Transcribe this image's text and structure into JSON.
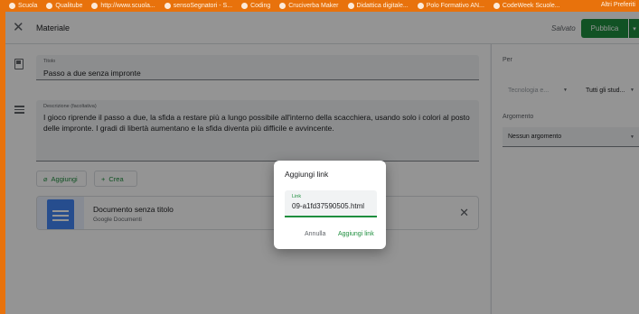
{
  "bookmarks": [
    {
      "label": "Scuola"
    },
    {
      "label": "Qualitube"
    },
    {
      "label": "http://www.scuola..."
    },
    {
      "label": "sensoSegnatori - S..."
    },
    {
      "label": "Coding"
    },
    {
      "label": "Cruciverba Maker"
    },
    {
      "label": "Didattica digitale..."
    },
    {
      "label": "Polo Formativo AN..."
    },
    {
      "label": "CodeWeek Scuole..."
    }
  ],
  "bookmarks_right": "Altri Preferiti",
  "header": {
    "title": "Materiale",
    "saved": "Salvato",
    "publish_label": "Pubblica"
  },
  "form": {
    "title_label": "Titolo",
    "title_value": "Passo a due senza impronte",
    "desc_label": "Descrizione (facoltativa)",
    "desc_value": "I gioco riprende il passo a due, la sfida a restare più a lungo possibile all'interno della scacchiera, usando solo i colori al posto delle impronte. I gradi di libertà aumentano e la sfida diventa più difficile e avvincente.",
    "add_label": "Aggiungi",
    "create_label": "Crea"
  },
  "attachment": {
    "name": "Documento senza titolo",
    "type": "Google Documenti"
  },
  "side": {
    "for_label": "Per",
    "class_value": "Tecnologia e...",
    "students_value": "Tutti gli stud...",
    "topic_label": "Argomento",
    "topic_value": "Nessun argomento"
  },
  "dialog": {
    "title": "Aggiungi link",
    "field_label": "Link",
    "field_value": "09-a1fd37590505.html",
    "cancel_label": "Annulla",
    "confirm_label": "Aggiungi link"
  },
  "colors": {
    "accent": "#1e8e3e",
    "bookmark_bar": "#e8720c"
  }
}
